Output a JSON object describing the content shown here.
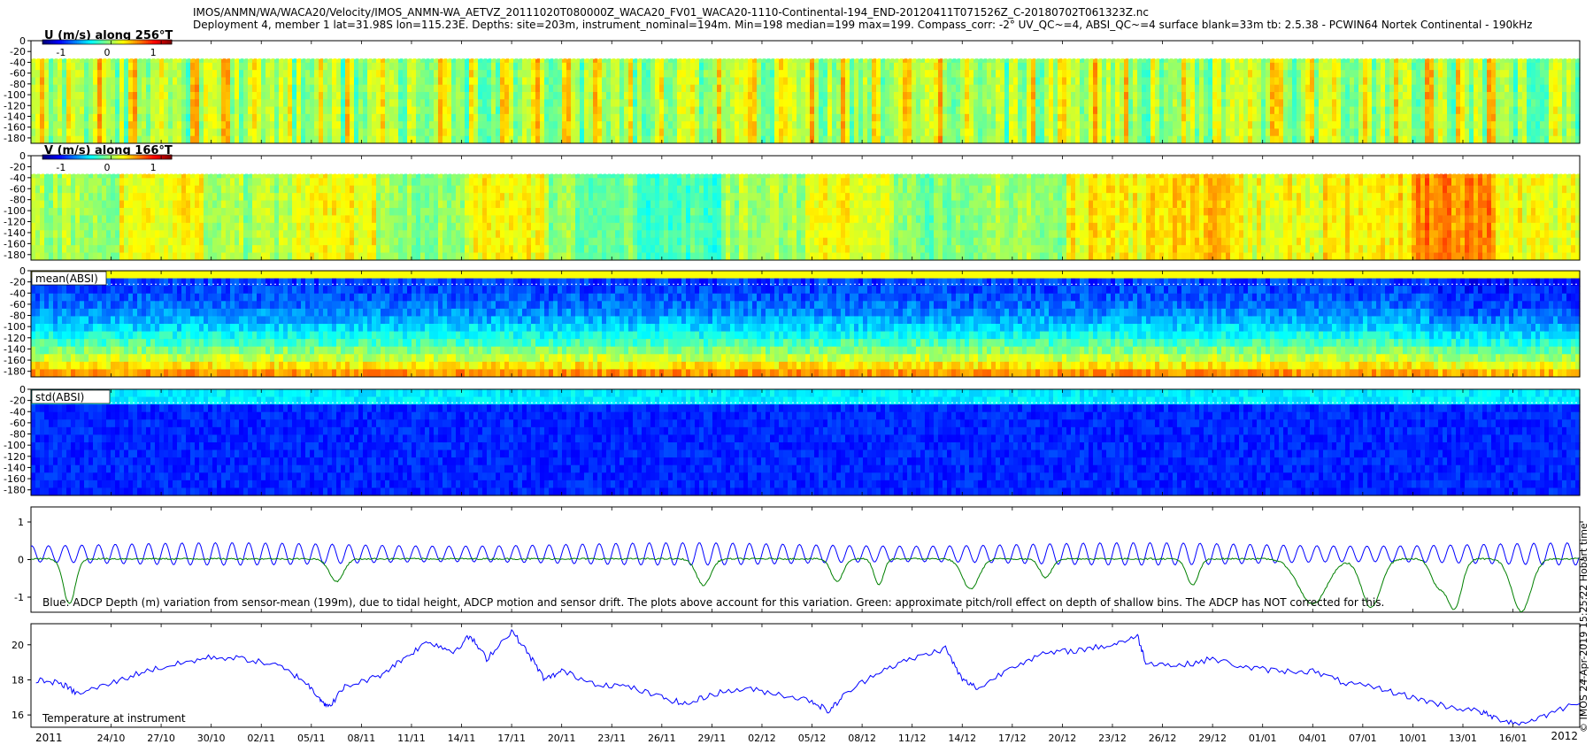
{
  "header": {
    "line1": "IMOS/ANMN/WA/WACA20/Velocity/IMOS_ANMN-WA_AETVZ_20111020T080000Z_WACA20_FV01_WACA20-1110-Continental-194_END-20120411T071526Z_C-20180702T061323Z.nc",
    "line2": "Deployment 4, member 1 lat=31.98S lon=115.23E. Depths: site=203m, instrument_nominal=194m. Min=198 median=199 max=199. Compass_corr: -2° UV_QC~=4, ABSI_QC~=4 surface blank=33m tb: 2.5.38 - PCWIN64 Nortek Continental - 190kHz"
  },
  "side": {
    "hobart": "IMOS 24-Apr-2019 15:25:22 Hobart time",
    "copyright_symbol": "©"
  },
  "chart_data": [
    {
      "type": "heatmap",
      "title": "U (m/s) along 256°T",
      "ylim": [
        -190,
        0
      ],
      "yticks": [
        0,
        -20,
        -40,
        -60,
        -80,
        -100,
        -120,
        -140,
        -160,
        -180
      ],
      "colorbar": {
        "ticks": [
          "-1",
          "0",
          "1"
        ],
        "range": [
          -1.4,
          1.4
        ]
      },
      "surface_blank_m": 33,
      "dominant_value": 0.05,
      "color_scale": "jet"
    },
    {
      "type": "heatmap",
      "title": "V (m/s) along 166°T",
      "ylim": [
        -190,
        0
      ],
      "yticks": [
        0,
        -20,
        -40,
        -60,
        -80,
        -100,
        -120,
        -140,
        -160,
        -180
      ],
      "colorbar": {
        "ticks": [
          "-1",
          "0",
          "1"
        ],
        "range": [
          -1.4,
          1.4
        ]
      },
      "surface_blank_m": 33,
      "band_values": [
        0.1,
        0.35,
        0.1,
        0.35,
        0.05,
        0.35,
        0.0,
        -0.15,
        0.1,
        0.3,
        0.0,
        0.1,
        0.35,
        0.5,
        0.3,
        0.4,
        0.7,
        0.3
      ],
      "color_scale": "jet"
    },
    {
      "type": "heatmap",
      "title": "mean(ABSI)",
      "ylim": [
        -190,
        0
      ],
      "yticks": [
        0,
        -20,
        -40,
        -60,
        -80,
        -100,
        -120,
        -140,
        -160,
        -180
      ],
      "color_scale": "jet"
    },
    {
      "type": "heatmap",
      "title": "std(ABSI)",
      "ylim": [
        -190,
        0
      ],
      "yticks": [
        0,
        -20,
        -40,
        -60,
        -80,
        -100,
        -120,
        -140,
        -160,
        -180
      ],
      "color_scale": "jet"
    },
    {
      "type": "line",
      "ylim": [
        -1.4,
        1.4
      ],
      "yticks": [
        "1",
        "0",
        "-1"
      ],
      "annotation": "Blue: ADCP Depth (m) variation from sensor-mean (199m), due to tidal height, ADCP motion and sensor drift. The plots above account for this variation. Green: approximate pitch/roll effect on depth of shallow bins. The ADCP has NOT corrected for this.",
      "series": [
        {
          "color": "#0000ff",
          "amplitude": 0.3,
          "period_days": 1.0,
          "mean": 0.15
        },
        {
          "color": "#008000",
          "baseline": 0.02,
          "dips": [
            {
              "day": -2.5,
              "depth": -1.2,
              "width": 0.5
            },
            {
              "day": 13.5,
              "depth": -0.6,
              "width": 0.6
            },
            {
              "day": 35.5,
              "depth": -0.7,
              "width": 0.6
            },
            {
              "day": 43.5,
              "depth": -0.6,
              "width": 0.5
            },
            {
              "day": 46.0,
              "depth": -0.7,
              "width": 0.4
            },
            {
              "day": 51.5,
              "depth": -0.8,
              "width": 0.7
            },
            {
              "day": 56.0,
              "depth": -0.5,
              "width": 0.5
            },
            {
              "day": 64.8,
              "depth": -0.7,
              "width": 0.5
            },
            {
              "day": 72.0,
              "depth": -1.2,
              "width": 1.2
            },
            {
              "day": 75.5,
              "depth": -1.3,
              "width": 0.8
            },
            {
              "day": 79.5,
              "depth": -0.7,
              "width": 0.6
            },
            {
              "day": 80.5,
              "depth": -1.3,
              "width": 0.6
            },
            {
              "day": 84.5,
              "depth": -1.4,
              "width": 0.8
            },
            {
              "day": 92.5,
              "depth": -1.4,
              "width": 1.2
            }
          ]
        }
      ]
    },
    {
      "type": "line",
      "ylim": [
        15.3,
        21.2
      ],
      "yticks": [
        "20",
        "18",
        "16"
      ],
      "annotation": "Temperature at instrument",
      "series": [
        {
          "color": "#0000ff",
          "points": [
            [
              -4.5,
              18.0
            ],
            [
              -3.0,
              17.8
            ],
            [
              -2.0,
              17.2
            ],
            [
              0,
              17.8
            ],
            [
              2,
              18.5
            ],
            [
              4,
              18.9
            ],
            [
              6,
              19.3
            ],
            [
              8,
              19.2
            ],
            [
              10,
              18.8
            ],
            [
              11.5,
              18.0
            ],
            [
              12.5,
              17.0
            ],
            [
              13.0,
              16.4
            ],
            [
              14.0,
              17.6
            ],
            [
              16,
              18.2
            ],
            [
              17.5,
              19.2
            ],
            [
              19,
              20.2
            ],
            [
              20.5,
              19.6
            ],
            [
              21.5,
              20.5
            ],
            [
              22.5,
              19.2
            ],
            [
              24,
              20.8
            ],
            [
              25,
              19.5
            ],
            [
              26,
              18.0
            ],
            [
              27,
              18.5
            ],
            [
              29,
              17.8
            ],
            [
              31,
              17.6
            ],
            [
              33,
              17.0
            ],
            [
              34.5,
              16.6
            ],
            [
              36,
              17.2
            ],
            [
              38,
              17.5
            ],
            [
              40,
              17.2
            ],
            [
              42,
              16.8
            ],
            [
              43,
              16.2
            ],
            [
              44,
              17.2
            ],
            [
              46,
              18.5
            ],
            [
              48,
              19.2
            ],
            [
              50,
              19.8
            ],
            [
              51,
              18.0
            ],
            [
              52,
              17.5
            ],
            [
              54,
              18.8
            ],
            [
              56,
              19.5
            ],
            [
              58,
              19.7
            ],
            [
              60,
              20.0
            ],
            [
              61.5,
              20.5
            ],
            [
              62,
              19.0
            ],
            [
              64,
              18.8
            ],
            [
              66,
              19.2
            ],
            [
              68,
              18.7
            ],
            [
              70,
              18.5
            ],
            [
              72,
              18.5
            ],
            [
              74,
              17.8
            ],
            [
              76,
              17.5
            ],
            [
              78,
              17.0
            ],
            [
              80,
              16.5
            ],
            [
              82,
              16.2
            ],
            [
              83,
              15.8
            ],
            [
              84.5,
              15.5
            ],
            [
              86,
              16.0
            ],
            [
              88,
              16.8
            ],
            [
              90,
              17.8
            ],
            [
              92,
              18.5
            ],
            [
              94,
              19.0
            ],
            [
              95.5,
              16.0
            ],
            [
              96,
              19.5
            ],
            [
              98,
              17.0
            ],
            [
              99,
              19.8
            ],
            [
              100,
              17.3
            ],
            [
              101,
              19.5
            ],
            [
              102.5,
              17.5
            ],
            [
              103.5,
              16.5
            ],
            [
              104,
              15.8
            ],
            [
              105,
              17.5
            ],
            [
              106,
              19.0
            ],
            [
              108,
              19.5
            ],
            [
              110,
              20.3
            ],
            [
              112,
              20.2
            ],
            [
              113,
              20.8
            ],
            [
              114,
              20.0
            ],
            [
              116,
              20.5
            ],
            [
              118,
              19.5
            ],
            [
              120,
              20.0
            ],
            [
              122,
              19.8
            ],
            [
              123,
              20.0
            ]
          ]
        }
      ]
    },
    {
      "type": "axis",
      "xticks": [
        {
          "day": 0,
          "label": "24/10"
        },
        {
          "day": 3,
          "label": "27/10"
        },
        {
          "day": 6,
          "label": "30/10"
        },
        {
          "day": 9,
          "label": "02/11"
        },
        {
          "day": 12,
          "label": "05/11"
        },
        {
          "day": 15,
          "label": "08/11"
        },
        {
          "day": 18,
          "label": "11/11"
        },
        {
          "day": 21,
          "label": "14/11"
        },
        {
          "day": 24,
          "label": "17/11"
        },
        {
          "day": 27,
          "label": "20/11"
        },
        {
          "day": 30,
          "label": "23/11"
        },
        {
          "day": 33,
          "label": "26/11"
        },
        {
          "day": 36,
          "label": "29/11"
        },
        {
          "day": 39,
          "label": "02/12"
        },
        {
          "day": 42,
          "label": "05/12"
        },
        {
          "day": 45,
          "label": "08/12"
        },
        {
          "day": 48,
          "label": "11/12"
        },
        {
          "day": 51,
          "label": "14/12"
        },
        {
          "day": 54,
          "label": "17/12"
        },
        {
          "day": 57,
          "label": "20/12"
        },
        {
          "day": 60,
          "label": "23/12"
        },
        {
          "day": 63,
          "label": "26/12"
        },
        {
          "day": 66,
          "label": "29/12"
        },
        {
          "day": 69,
          "label": "01/01"
        },
        {
          "day": 72,
          "label": "04/01"
        },
        {
          "day": 75,
          "label": "07/01"
        },
        {
          "day": 78,
          "label": "10/01"
        },
        {
          "day": 81,
          "label": "13/01"
        },
        {
          "day": 84,
          "label": "16/01"
        }
      ],
      "xlim": [
        -4.8,
        88.0
      ],
      "year_left": "2011",
      "year_right": "2012"
    }
  ]
}
